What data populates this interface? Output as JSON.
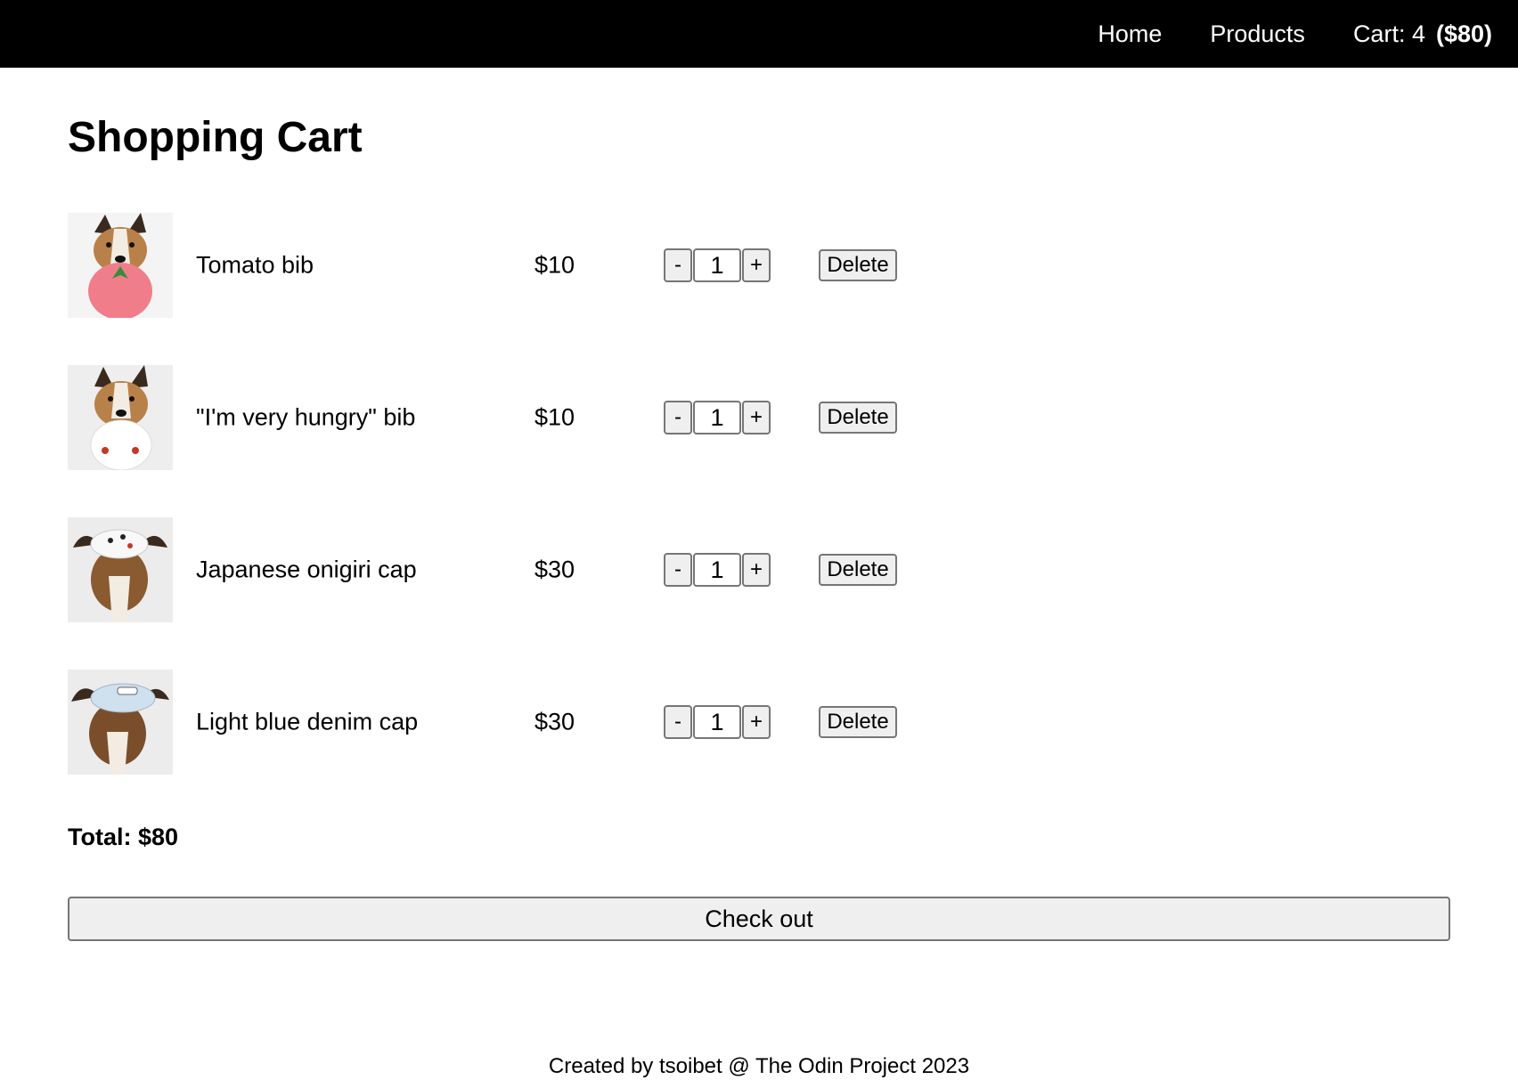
{
  "nav": {
    "home": "Home",
    "products": "Products",
    "cart_label": "Cart: 4",
    "cart_total": "($80)"
  },
  "page": {
    "title": "Shopping Cart"
  },
  "items": [
    {
      "name": "Tomato bib",
      "price": "$10",
      "quantity": "1",
      "image": "dog-tomato-bib-photo"
    },
    {
      "name": "\"I'm very hungry\" bib",
      "price": "$10",
      "quantity": "1",
      "image": "dog-hungry-bib-photo"
    },
    {
      "name": "Japanese onigiri cap",
      "price": "$30",
      "quantity": "1",
      "image": "dog-onigiri-cap-photo"
    },
    {
      "name": "Light blue denim cap",
      "price": "$30",
      "quantity": "1",
      "image": "dog-denim-cap-photo"
    }
  ],
  "buttons": {
    "decrement": "-",
    "increment": "+",
    "delete": "Delete",
    "checkout": "Check out"
  },
  "total": "Total: $80",
  "footer": "Created by tsoibet @ The Odin Project 2023"
}
